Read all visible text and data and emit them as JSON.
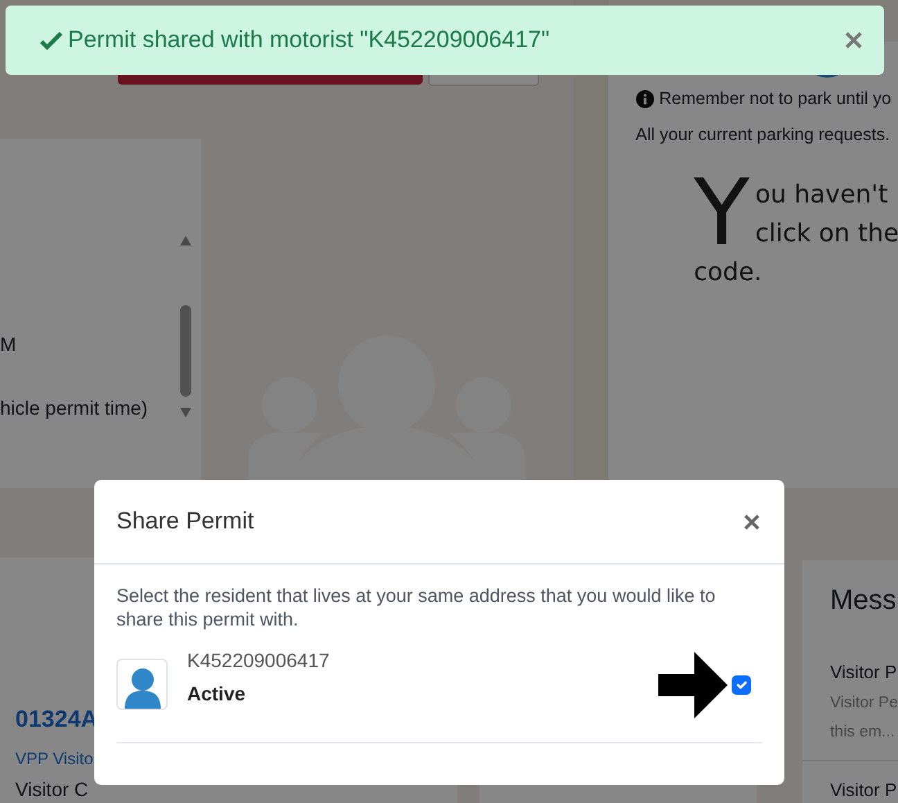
{
  "toast": {
    "message": "Permit shared with motorist \"K452209006417\""
  },
  "background": {
    "left_card": {
      "lines": [
        "M",
        "hicle permit time)"
      ]
    },
    "notice_card": {
      "reminder": "Remember not to park until yo",
      "requests": "All your current parking requests.",
      "drop_cap": "Y",
      "message_lines": [
        "ou haven't",
        "click on the",
        "code."
      ]
    },
    "permit_card": {
      "number": "01324A",
      "type": "VPP Visito",
      "label": "Visitor C"
    },
    "messages_card": {
      "title": "Mess",
      "items": [
        {
          "title": "Visitor P",
          "body": [
            "Visitor Pe",
            "this em..."
          ]
        },
        {
          "title": "Visitor P"
        }
      ]
    }
  },
  "modal": {
    "title": "Share Permit",
    "instructions": "Select the resident that lives at your same address that you would like to share this permit with.",
    "residents": [
      {
        "id": "K452209006417",
        "status": "Active",
        "selected": true
      }
    ]
  }
}
